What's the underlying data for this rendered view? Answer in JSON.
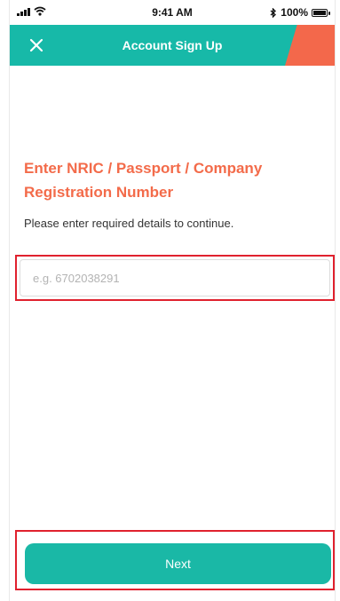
{
  "status_bar": {
    "time": "9:41 AM",
    "battery": "100%",
    "battery_level": 1.0
  },
  "header": {
    "title": "Account Sign Up",
    "close_icon": "close-icon"
  },
  "form": {
    "heading": "Enter NRIC / Passport / Company Registration Number",
    "subtext": "Please enter required details to continue.",
    "id_input": {
      "value": "",
      "placeholder": "e.g. 6702038291"
    },
    "next_label": "Next"
  },
  "colors": {
    "primary": "#17b9a8",
    "accent": "#f3684b",
    "highlight": "#e0212e"
  }
}
